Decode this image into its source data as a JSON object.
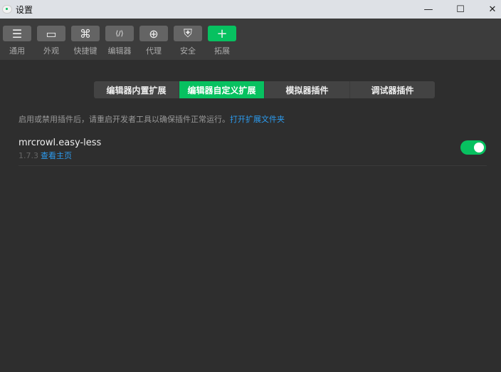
{
  "window": {
    "title": "设置",
    "minimize": "—",
    "maximize": "☐",
    "close": "✕"
  },
  "toolbar": [
    {
      "label": "通用",
      "icon": "sliders-icon",
      "glyph": "☰"
    },
    {
      "label": "外观",
      "icon": "window-icon",
      "glyph": "▭"
    },
    {
      "label": "快捷键",
      "icon": "command-icon",
      "glyph": "⌘"
    },
    {
      "label": "编辑器",
      "icon": "code-icon",
      "glyph": "⟨/⟩"
    },
    {
      "label": "代理",
      "icon": "globe-icon",
      "glyph": "⊕"
    },
    {
      "label": "安全",
      "icon": "shield-icon",
      "glyph": "⛨"
    },
    {
      "label": "拓展",
      "icon": "plus-icon",
      "glyph": "+"
    }
  ],
  "tabs": [
    "编辑器内置扩展",
    "编辑器自定义扩展",
    "模拟器插件",
    "调试器插件"
  ],
  "active_tab": 1,
  "hint": {
    "text": "启用或禁用插件后，请重启开发者工具以确保插件正常运行。",
    "link": "打开扩展文件夹"
  },
  "extensions": [
    {
      "name": "mrcrowl.easy-less",
      "version": "1.7.3",
      "homepage": "查看主页",
      "enabled": true
    }
  ],
  "colors": {
    "accent": "#07c160",
    "link": "#2c9cf0"
  }
}
